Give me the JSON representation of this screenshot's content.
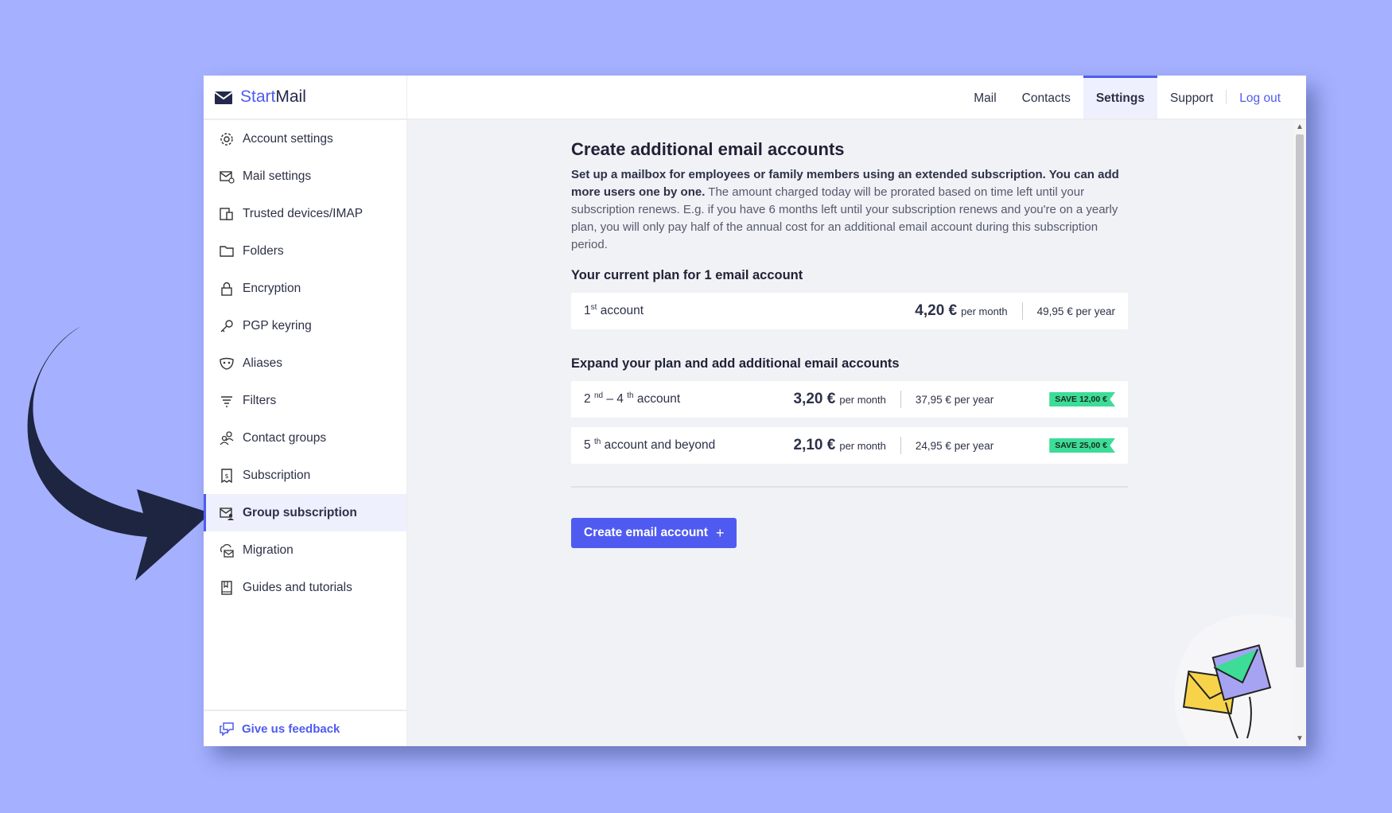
{
  "brand": {
    "part1": "Start",
    "part2": "Mail"
  },
  "sidebar": {
    "items": [
      {
        "label": "Account settings",
        "icon": "gear-icon"
      },
      {
        "label": "Mail settings",
        "icon": "mail-settings-icon"
      },
      {
        "label": "Trusted devices/IMAP",
        "icon": "devices-icon"
      },
      {
        "label": "Folders",
        "icon": "folder-icon"
      },
      {
        "label": "Encryption",
        "icon": "lock-icon"
      },
      {
        "label": "PGP keyring",
        "icon": "key-icon"
      },
      {
        "label": "Aliases",
        "icon": "mask-icon"
      },
      {
        "label": "Filters",
        "icon": "filter-icon"
      },
      {
        "label": "Contact groups",
        "icon": "contact-groups-icon"
      },
      {
        "label": "Subscription",
        "icon": "receipt-icon"
      },
      {
        "label": "Group subscription",
        "icon": "group-mail-icon"
      },
      {
        "label": "Migration",
        "icon": "cloud-mail-icon"
      },
      {
        "label": "Guides and tutorials",
        "icon": "book-icon"
      }
    ],
    "active": "Group subscription",
    "feedback": "Give us feedback"
  },
  "topnav": {
    "mail": "Mail",
    "contacts": "Contacts",
    "settings": "Settings",
    "support": "Support",
    "logout": "Log out"
  },
  "main": {
    "title": "Create additional email accounts",
    "desc_bold": "Set up a mailbox for employees or family members using an extended subscription. You can add more users one by one.",
    "desc_rest": " The amount charged today will be prorated based on time left until your subscription renews. E.g. if you have 6 months left until your subscription renews and you're on a yearly plan, you will only pay half of the annual cost for an additional email account during this subscription period.",
    "current_heading": "Your current plan for 1 email account",
    "current_plan": {
      "num": "1",
      "sup": "st",
      "text": " account",
      "price": "4,20 €",
      "per_month": "per month",
      "year_price": "49,95 €",
      "per_year": "per year"
    },
    "expand_heading": "Expand your plan and add additional email accounts",
    "tier2": {
      "n1": "2",
      "s1": "nd",
      "dash": " – ",
      "n2": "4",
      "s2": "th",
      "text": " account",
      "price": "3,20 €",
      "per_month": "per month",
      "year_price": "37,95 €",
      "per_year": "per year",
      "badge": "SAVE 12,00 €"
    },
    "tier3": {
      "num": "5",
      "sup": "th",
      "text": " account and beyond",
      "price": "2,10 €",
      "per_month": "per month",
      "year_price": "24,95 €",
      "per_year": "per year",
      "badge": "SAVE 25,00 €"
    },
    "button": "Create email account",
    "button_icon": "+"
  },
  "colors": {
    "accent": "#4f5bf0",
    "badge": "#3ddc97",
    "background": "#a5b1ff",
    "arrow": "#1e2540"
  }
}
